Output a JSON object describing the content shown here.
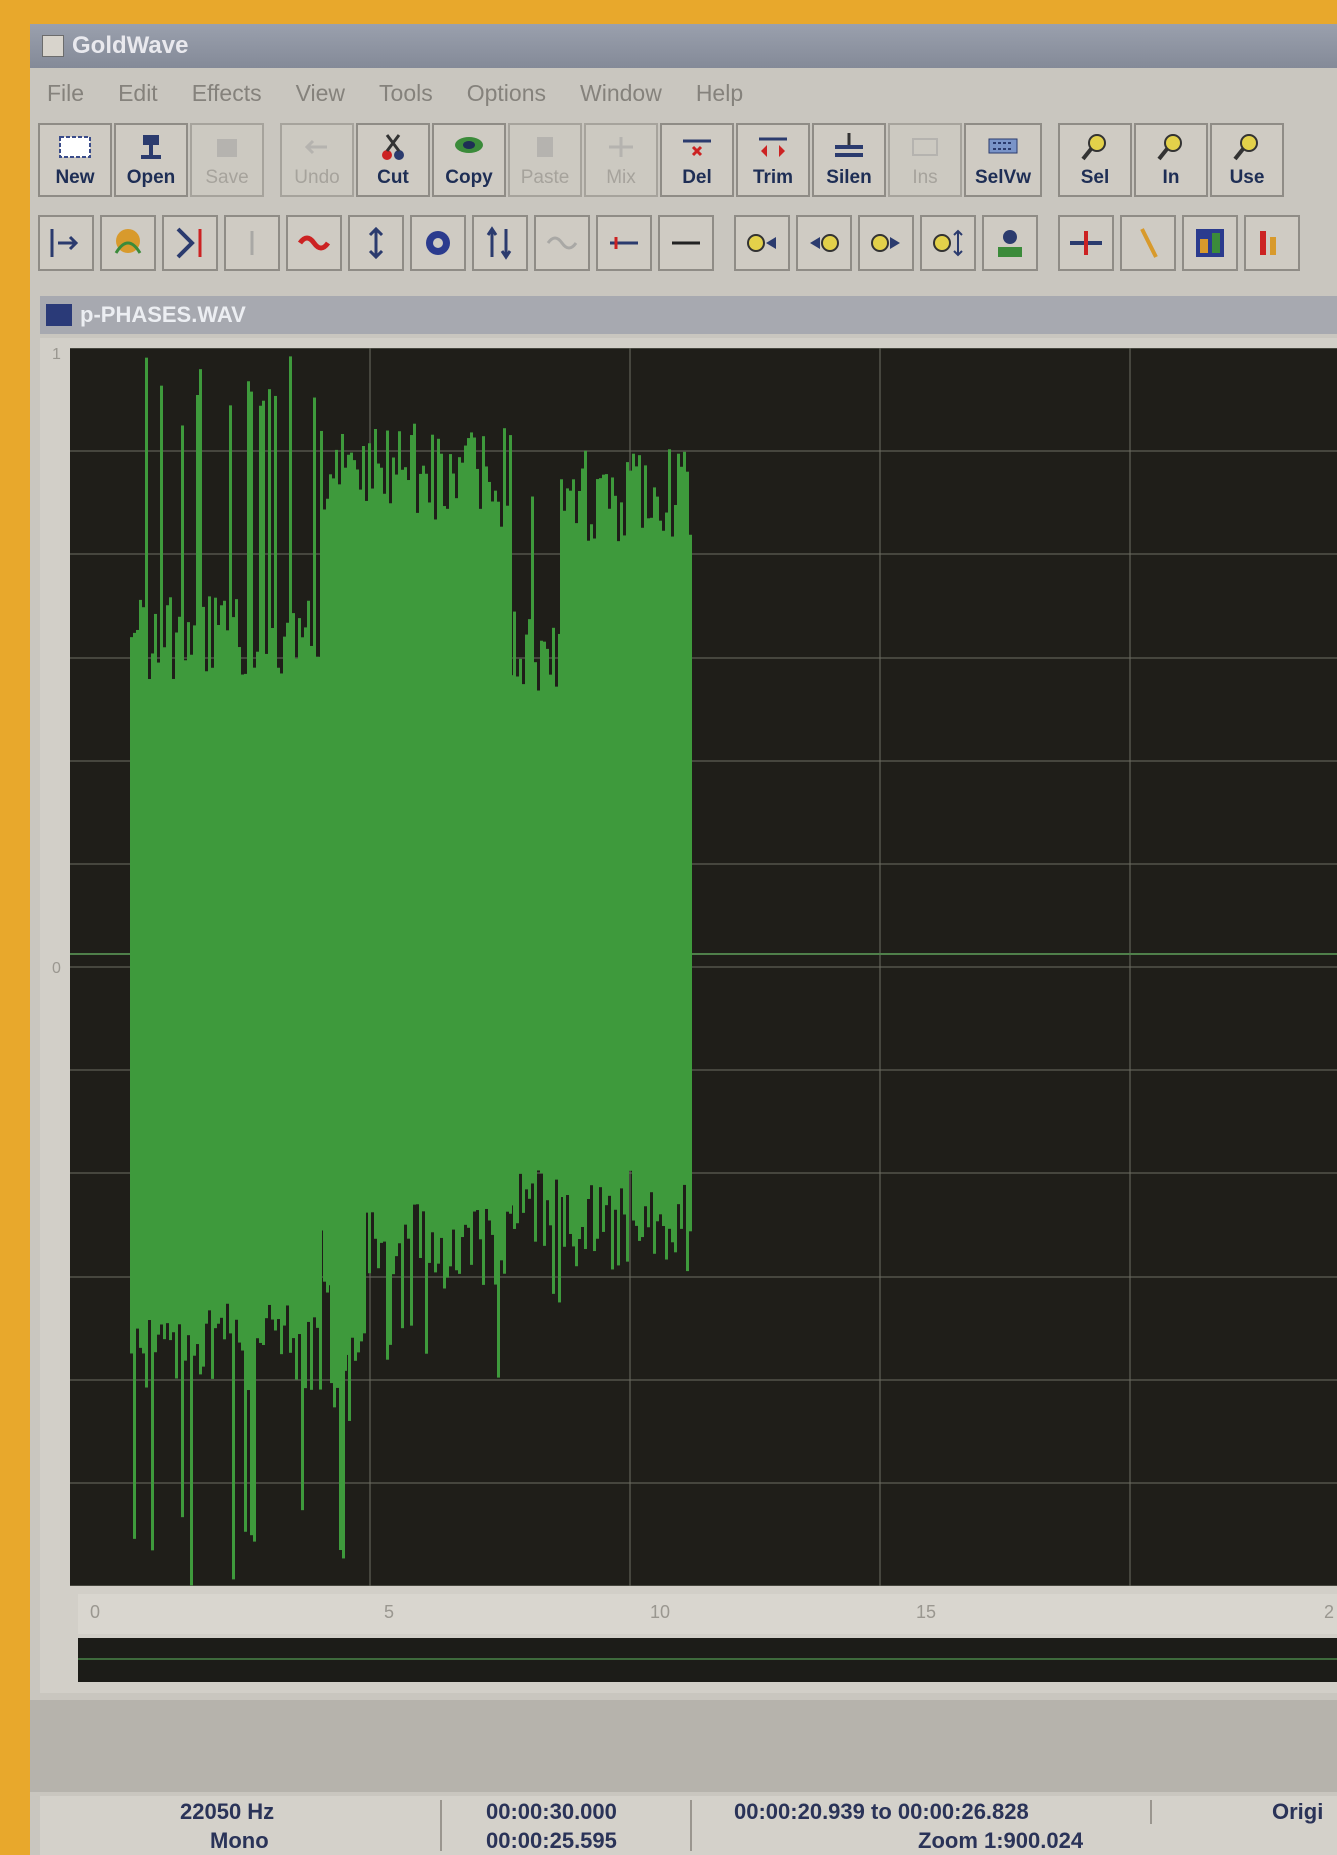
{
  "window": {
    "title": "GoldWave"
  },
  "menu": [
    "File",
    "Edit",
    "Effects",
    "View",
    "Tools",
    "Options",
    "Window",
    "Help"
  ],
  "toolbar_main": [
    {
      "label": "New",
      "icon": "new-file-icon",
      "enabled": true
    },
    {
      "label": "Open",
      "icon": "open-folder-icon",
      "enabled": true
    },
    {
      "label": "Save",
      "icon": "save-icon",
      "enabled": false
    },
    {
      "label": "Undo",
      "icon": "undo-icon",
      "enabled": false
    },
    {
      "label": "Cut",
      "icon": "scissors-icon",
      "enabled": true
    },
    {
      "label": "Copy",
      "icon": "copy-icon",
      "enabled": true
    },
    {
      "label": "Paste",
      "icon": "paste-icon",
      "enabled": false
    },
    {
      "label": "Mix",
      "icon": "mix-icon",
      "enabled": false
    },
    {
      "label": "Del",
      "icon": "delete-icon",
      "enabled": true
    },
    {
      "label": "Trim",
      "icon": "trim-icon",
      "enabled": true
    },
    {
      "label": "Silen",
      "icon": "silence-icon",
      "enabled": true
    },
    {
      "label": "Ins",
      "icon": "insert-icon",
      "enabled": false
    },
    {
      "label": "SelVw",
      "icon": "select-view-icon",
      "enabled": true
    },
    {
      "label": "Sel",
      "icon": "zoom-select-icon",
      "enabled": true
    },
    {
      "label": "In",
      "icon": "zoom-in-icon",
      "enabled": true
    },
    {
      "label": "Use",
      "icon": "zoom-use-icon",
      "enabled": true
    }
  ],
  "toolbar_effects": [
    "offset-icon",
    "filter-icon",
    "reverse-icon",
    "pitch-icon",
    "echo-icon",
    "resize-icon",
    "doppler-icon",
    "equalizer-icon",
    "flanger-icon",
    "fade-icon",
    "line-icon",
    "fade-in-icon",
    "fade-out-left-icon",
    "fade-out-right-icon",
    "volume-icon",
    "speaker-icon",
    "match-icon",
    "marker-icon",
    "spectrum-icon",
    "meter-icon"
  ],
  "document": {
    "title": "p-PHASES.WAV"
  },
  "wave_axis": {
    "top": "1",
    "mid": "0"
  },
  "ruler_labels": [
    "0",
    "5",
    "10",
    "15",
    "2"
  ],
  "status": {
    "sample_rate": "22050 Hz",
    "channels": "Mono",
    "length": "00:00:30.000",
    "position": "00:00:25.595",
    "selection": "00:00:20.939 to 00:00:26.828",
    "zoom": "Zoom 1:900.024",
    "mode": "Origi"
  },
  "colors": {
    "waveform": "#3e9a3c",
    "background": "#1f1e19",
    "grid": "#6b6b60",
    "accent": "#e8a82c"
  }
}
